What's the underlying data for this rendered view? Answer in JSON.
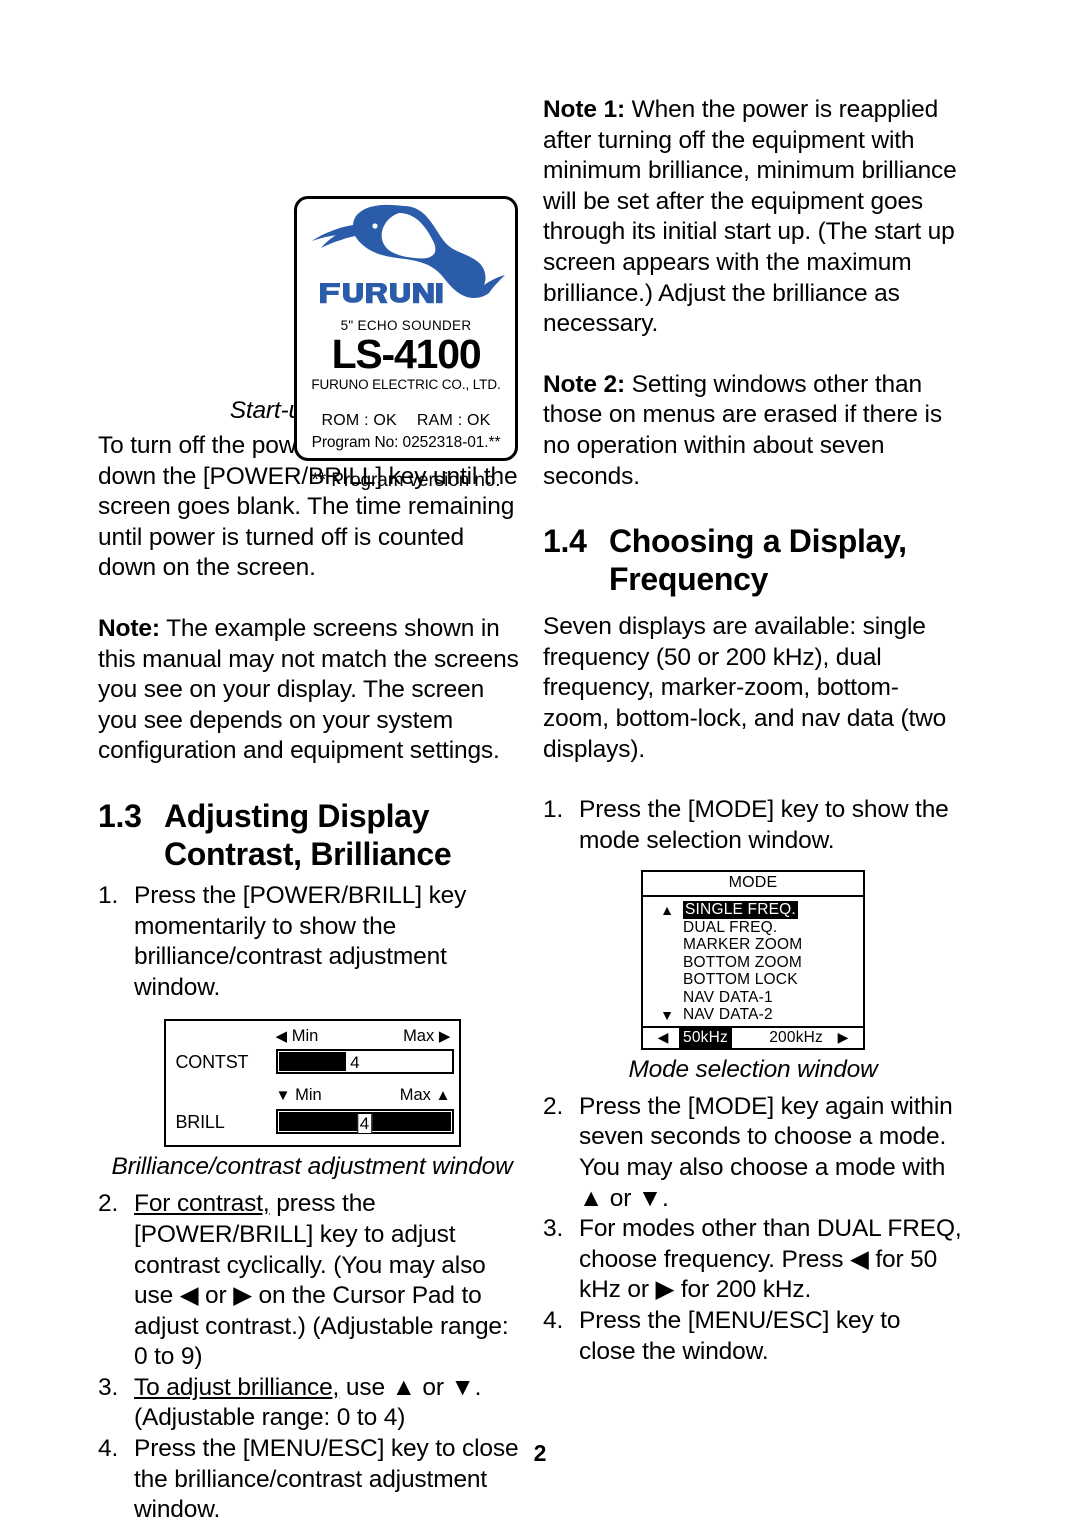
{
  "page": {
    "number": "2"
  },
  "startup_screen": {
    "logo_alt": "FURUNO sailfish logo",
    "wordmark": "FURUNO",
    "echo_sounder": "5\" ECHO SOUNDER",
    "model": "LS-4100",
    "company": "FURUNO ELECTRIC CO., LTD.",
    "rom": "ROM : OK",
    "ram": "RAM : OK",
    "program_no": "Program No: 0252318-01.**",
    "version_note": "** Program version no.",
    "caption": "Start-up screen",
    "brand_color": "#2a5caa"
  },
  "left_column": {
    "para_power_off": "To turn off the power, press and hold down the [POWER/BRILL] key until the screen goes blank. The time remaining until power is turned off is counted down on the screen.",
    "note_label": "Note:",
    "note_text": " The example screens shown in this manual may not match the screens you see on your display. The screen you see depends on your system configuration and equipment settings.",
    "section": {
      "number": "1.3",
      "title_line1": "Adjusting Display",
      "title_line2": "Contrast, Brilliance"
    },
    "steps": [
      {
        "marker": "1.",
        "text": "Press the [POWER/BRILL] key momentarily to show the brilliance/contrast adjustment window."
      },
      {
        "marker": "2.",
        "underlined": "For contrast,",
        "text": " press the [POWER/BRILL] key to adjust contrast cyclically. (You may also use ◀ or ▶ on the Cursor Pad to adjust contrast.) (Adjustable range: 0 to 9)"
      },
      {
        "marker": "3.",
        "underlined": "To adjust brilliance,",
        "text": " use ▲ or ▼. (Adjustable range: 0 to 4)"
      },
      {
        "marker": "4.",
        "text": "Press the [MENU/ESC] key to close the brilliance/contrast adjustment window."
      }
    ]
  },
  "bc_window": {
    "contrast": {
      "left_arrow": "◀",
      "min_label": "Min",
      "max_label": "Max",
      "right_arrow": "▶",
      "row_label": "CONTST",
      "value": "4",
      "fill_percent": 40
    },
    "brill": {
      "down_arrow": "▼",
      "min_label": "Min",
      "max_label": "Max",
      "up_arrow": "▲",
      "row_label": "BRILL",
      "value": "4",
      "fill_percent": 100
    },
    "caption": "Brilliance/contrast adjustment window"
  },
  "right_column": {
    "note1_label": "Note 1:",
    "note1_text": " When the power is reapplied after turning off the equipment with minimum brilliance, minimum brilliance will be set after the equipment goes through its initial start up. (The start up screen appears with the maximum brilliance.) Adjust the brilliance as necessary.",
    "note2_label": "Note 2:",
    "note2_text": " Setting windows other than those on menus are erased if there is no operation within about seven seconds.",
    "section": {
      "number": "1.4",
      "title_line1": "Choosing a Display,",
      "title_line2": "Frequency"
    },
    "intro": "Seven displays are available: single frequency (50 or 200 kHz), dual frequency, marker-zoom, bottom-zoom, bottom-lock, and nav data (two displays).",
    "steps_before": [
      {
        "marker": "1.",
        "text": "Press the [MODE] key to show the mode selection window."
      }
    ],
    "steps_after": [
      {
        "marker": "2.",
        "text": "Press the [MODE] key again within seven seconds to choose a mode. You may also choose a mode with ▲ or ▼."
      },
      {
        "marker": "3.",
        "text": "For modes other than DUAL FREQ, choose frequency. Press ◀ for 50 kHz or ▶ for 200 kHz."
      },
      {
        "marker": "4.",
        "text": "Press the [MENU/ESC] key to close the window."
      }
    ]
  },
  "mode_window": {
    "title": "MODE",
    "up_arrow": "▲",
    "down_arrow": "▼",
    "items": [
      "SINGLE FREQ.",
      "DUAL FREQ.",
      "MARKER ZOOM",
      "BOTTOM ZOOM",
      "BOTTOM LOCK",
      "NAV DATA-1",
      "NAV DATA-2"
    ],
    "selected_index": 0,
    "freq_left_arrow": "◀",
    "freq_right_arrow": "▶",
    "freq_50": "50kHz",
    "freq_200": "200kHz",
    "freq_selected": "50kHz",
    "caption": "Mode selection window"
  }
}
